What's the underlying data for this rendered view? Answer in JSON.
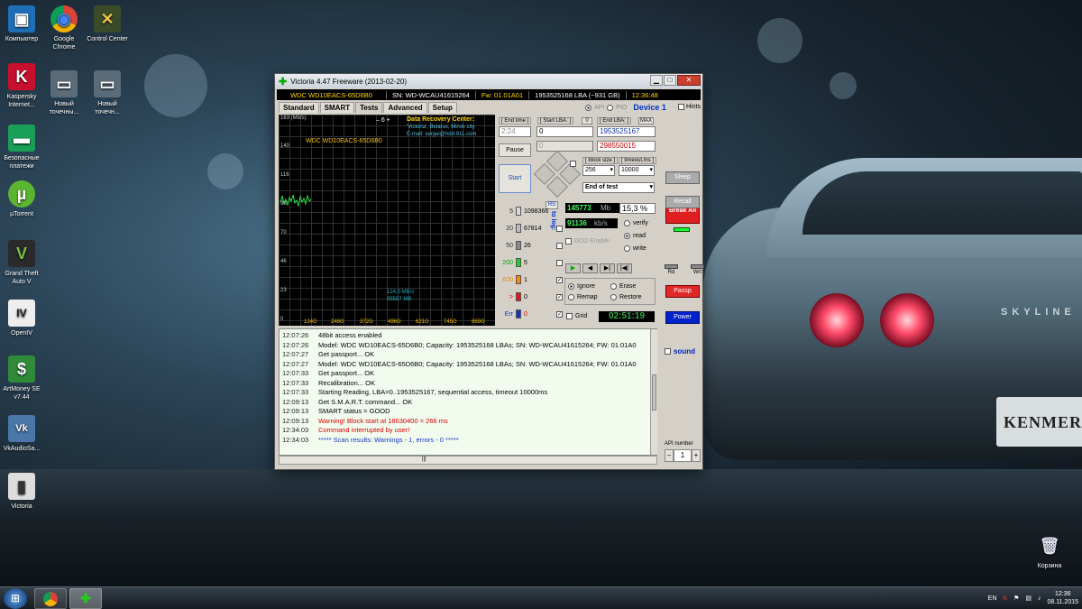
{
  "desktop": {
    "icons": [
      {
        "label": "Компьютер",
        "glyph": "▣"
      },
      {
        "label": "Google Chrome",
        "glyph": "◉"
      },
      {
        "label": "Control Center",
        "glyph": "✕"
      },
      {
        "label": "Kaspersky Internet...",
        "glyph": "K"
      },
      {
        "label": "Новый точечны...",
        "glyph": "▭"
      },
      {
        "label": "Новый точечн...",
        "glyph": "▭"
      },
      {
        "label": "Безопасные платежи",
        "glyph": "▬"
      },
      {
        "label": "µTorrent",
        "glyph": "µ"
      },
      {
        "label": "Grand Theft Auto V",
        "glyph": "V"
      },
      {
        "label": "OpenIV",
        "glyph": "IV"
      },
      {
        "label": "ArtMoney SE v7.44",
        "glyph": "$"
      },
      {
        "label": "VkAudioSa...",
        "glyph": "Vk"
      },
      {
        "label": "Victoria",
        "glyph": "▮"
      },
      {
        "label": "Корзина",
        "glyph": "🗑"
      }
    ],
    "car_brand": "SKYLINE",
    "plate_text": "KENMER"
  },
  "window": {
    "title": "Victoria 4.47  Freeware (2013-02-20)",
    "minimize": "▁",
    "maximize": "□",
    "close": "✕",
    "info": {
      "model": "WDC WD10EACS-65D6B0",
      "serial": "SN: WD-WCAU41615264",
      "firmware": "Fw: 01.01A01",
      "lba": "1953525168 LBA (~931 GB)",
      "time": "12:36:48"
    },
    "tabs": [
      "Standard",
      "SMART",
      "Tests",
      "Advanced",
      "Setup"
    ],
    "api_label": "API",
    "pio_label": "PIO",
    "device": "Device 1",
    "hints": "Hints",
    "graph": {
      "ymax": "163 (Mb/s)",
      "y_labels": [
        "140",
        "116",
        "93",
        "70",
        "46",
        "23",
        "0"
      ],
      "x_labels": [
        "124G",
        "248G",
        "372G",
        "496G",
        "621G",
        "745G",
        "869G"
      ],
      "drive_label": "WDC WD10EACS-65D6B0",
      "nav": "–   6   +",
      "drc_title": "Data Recovery Center:",
      "drc_line1": "'Victoria', Belarus, Minsk city",
      "drc_line2": "E-mail: sergei@hdd-911.com",
      "speed1": "124,0 MB/s",
      "speed2": "95597 MB"
    },
    "controls": {
      "end_time_label": "[ End time ]",
      "start_lba_label": "[ Start LBA: ]",
      "start_lba_btn": "0",
      "end_lba_label": "[ End LBA: ]",
      "max_btn": "MAX",
      "end_time_value": "2:24",
      "start_lba_value": "0",
      "end_lba_value": "1953525167",
      "pos_value": "0",
      "current_lba": "298550015",
      "pause": "Pause",
      "start": "Start",
      "block_size_label": "[ block size ]",
      "timeout_label": "[ timeout,ms ]",
      "block_size": "256",
      "timeout": "10000",
      "end_action": "End of test"
    },
    "blocks": [
      {
        "lbl": "5",
        "color": "#d8d8d8",
        "count": "1098366",
        "checked": false
      },
      {
        "lbl": "20",
        "color": "#bdbdbd",
        "count": "67814",
        "checked": false
      },
      {
        "lbl": "50",
        "color": "#8a8a8a",
        "count": "26",
        "checked": false
      },
      {
        "lbl": "200",
        "color": "#22cc22",
        "count": "5",
        "checked": false
      },
      {
        "lbl": "600",
        "color": "#ff8800",
        "count": "1",
        "checked": true
      },
      {
        "lbl": ">",
        "color": "#ee1111",
        "count": "0",
        "checked": true
      },
      {
        "lbl": "Err",
        "color": "#1133cc",
        "count": "0",
        "checked": true
      }
    ],
    "rs_label": "RS",
    "to_log_label": "to log:",
    "stats": {
      "done_mb": "145773",
      "mb_unit": "Mb",
      "percent": "15,3",
      "percent_unit": "%",
      "speed_kbs": "91136",
      "speed_unit": "kb/s",
      "ddd_enable": "DDD Enable",
      "modes": [
        "verify",
        "read",
        "write"
      ],
      "selected_mode": "read",
      "actions": [
        "Ignore",
        "Erase",
        "Remap",
        "Restore"
      ],
      "grid_label": "Grid",
      "elapsed": "02:51:19"
    },
    "right_buttons": {
      "break_all": "Break All",
      "sleep": "Sleep",
      "recall": "Recall",
      "rd": "Rd",
      "wrt": "Wrt",
      "passp": "Passp",
      "power": "Power",
      "sound": "sound",
      "api_number_label": "API number",
      "api_minus": "–",
      "api_value": "1",
      "api_plus": "+"
    },
    "log": [
      {
        "t": "12:07:26",
        "m": "48bit access enabled",
        "kind": "normal"
      },
      {
        "t": "12:07:26",
        "m": "Model: WDC WD10EACS-65D6B0; Capacity: 1953525168 LBAs; SN: WD-WCAU41615264; FW: 01.01A0",
        "kind": "normal"
      },
      {
        "t": "12:07:27",
        "m": "Get passport... OK",
        "kind": "normal"
      },
      {
        "t": "12:07:27",
        "m": "Model: WDC WD10EACS-65D6B0; Capacity: 1953525168 LBAs; SN: WD-WCAU41615264; FW: 01.01A0",
        "kind": "normal"
      },
      {
        "t": "12:07:33",
        "m": "Get passport... OK",
        "kind": "normal"
      },
      {
        "t": "12:07:33",
        "m": "Recalibration... OK",
        "kind": "normal"
      },
      {
        "t": "12:07:33",
        "m": "Starting Reading, LBA=0..1953525167, sequential access, timeout 10000ms",
        "kind": "normal"
      },
      {
        "t": "12:09:13",
        "m": "Get S.M.A.R.T. command... OK",
        "kind": "normal"
      },
      {
        "t": "12:09:13",
        "m": "SMART status = GOOD",
        "kind": "normal"
      },
      {
        "t": "12:09:13",
        "m": "Warning! Block start at 18630400 = 266 ms",
        "kind": "warn"
      },
      {
        "t": "12:34:03",
        "m": "Command interrupted by user!",
        "kind": "warn"
      },
      {
        "t": "12:34:03",
        "m": "***** Scan results: Warnings - 1, errors - 0 *****",
        "kind": "res"
      }
    ],
    "hscroll_grip": "|||"
  },
  "taskbar": {
    "start_glyph": "⊞",
    "lang": "EN",
    "time": "12:36",
    "date": "08.11.2015"
  }
}
